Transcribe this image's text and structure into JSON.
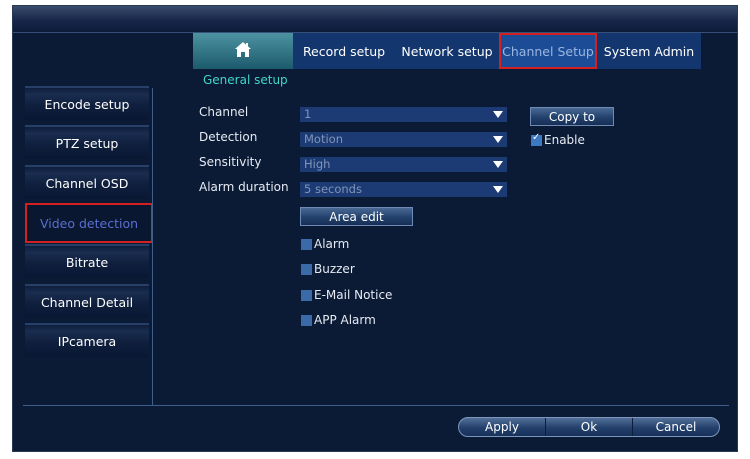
{
  "tabs": [
    {
      "label": "",
      "icon": "home-icon"
    },
    {
      "label": "Record setup"
    },
    {
      "label": "Network setup"
    },
    {
      "label": "Channel Setup",
      "selected": true
    },
    {
      "label": "System Admin"
    }
  ],
  "subtitle": "General setup",
  "sidebar": {
    "items": [
      {
        "label": "Encode setup"
      },
      {
        "label": "PTZ setup"
      },
      {
        "label": "Channel OSD"
      },
      {
        "label": "Video detection",
        "selected": true
      },
      {
        "label": "Bitrate"
      },
      {
        "label": "Channel Detail"
      },
      {
        "label": "IPcamera"
      }
    ]
  },
  "form": {
    "channel_label": "Channel",
    "channel_value": "1",
    "detection_label": "Detection",
    "detection_value": "Motion",
    "sensitivity_label": "Sensitivity",
    "sensitivity_value": "High",
    "alarm_duration_label": "Alarm duration",
    "alarm_duration_value": "5 seconds",
    "copy_to": "Copy to",
    "enable": "Enable",
    "enable_checked": true,
    "area_edit": "Area edit",
    "alarm": "Alarm",
    "buzzer": "Buzzer",
    "email_notice": "E-Mail Notice",
    "app_alarm": "APP Alarm"
  },
  "footer": {
    "apply": "Apply",
    "ok": "Ok",
    "cancel": "Cancel"
  },
  "colors": {
    "background": "#0b1a35",
    "accent": "#41d7c7",
    "selection_border": "#d42020",
    "tab_bg": "#14366e"
  }
}
